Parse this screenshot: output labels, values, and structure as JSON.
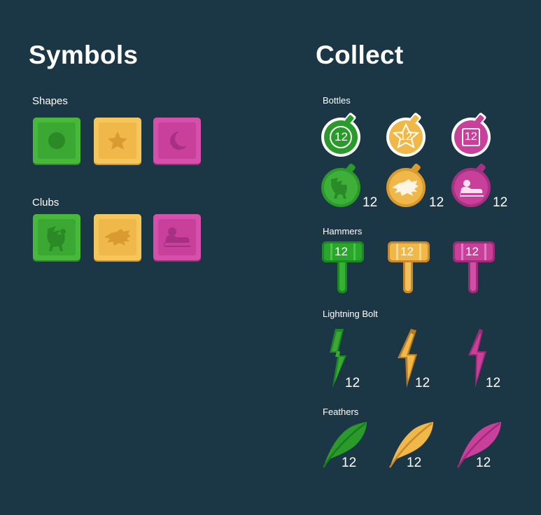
{
  "symbols": {
    "title": "Symbols",
    "shapes": {
      "label": "Shapes",
      "tiles": [
        {
          "color": "green",
          "icon": "circle-icon"
        },
        {
          "color": "yellow",
          "icon": "star-icon"
        },
        {
          "color": "pink",
          "icon": "moon-icon"
        }
      ]
    },
    "clubs": {
      "label": "Clubs",
      "tiles": [
        {
          "color": "green",
          "icon": "griffin-icon"
        },
        {
          "color": "yellow",
          "icon": "dragon-icon"
        },
        {
          "color": "pink",
          "icon": "sphinx-icon"
        }
      ]
    }
  },
  "collect": {
    "title": "Collect",
    "bottles": {
      "label": "Bottles",
      "row1": [
        {
          "color": "green",
          "icon": "round-bottle-icon",
          "value": "12"
        },
        {
          "color": "yellow",
          "icon": "star-bottle-icon",
          "value": "12"
        },
        {
          "color": "pink",
          "icon": "square-bottle-icon",
          "value": "12"
        }
      ],
      "row2": [
        {
          "color": "green",
          "icon": "griffin-bottle-icon",
          "value": "12"
        },
        {
          "color": "yellow",
          "icon": "dragon-bottle-icon",
          "value": "12"
        },
        {
          "color": "pink",
          "icon": "sphinx-bottle-icon",
          "value": "12"
        }
      ]
    },
    "hammers": {
      "label": "Hammers",
      "items": [
        {
          "color": "green",
          "icon": "hammer-icon",
          "value": "12"
        },
        {
          "color": "yellow",
          "icon": "hammer-icon",
          "value": "12"
        },
        {
          "color": "pink",
          "icon": "hammer-icon",
          "value": "12"
        }
      ]
    },
    "lightning": {
      "label": "Lightning Bolt",
      "items": [
        {
          "color": "green",
          "icon": "lightning-bolt-icon",
          "value": "12"
        },
        {
          "color": "yellow",
          "icon": "lightning-bolt-icon",
          "value": "12"
        },
        {
          "color": "pink",
          "icon": "lightning-bolt-icon",
          "value": "12"
        }
      ]
    },
    "feathers": {
      "label": "Feathers",
      "items": [
        {
          "color": "green",
          "icon": "feather-icon",
          "value": "12"
        },
        {
          "color": "yellow",
          "icon": "feather-icon",
          "value": "12"
        },
        {
          "color": "pink",
          "icon": "feather-icon",
          "value": "12"
        }
      ]
    }
  },
  "colors": {
    "background": "#1b3746",
    "green": "#3aa832",
    "yellow": "#efb848",
    "pink": "#c9409a"
  }
}
